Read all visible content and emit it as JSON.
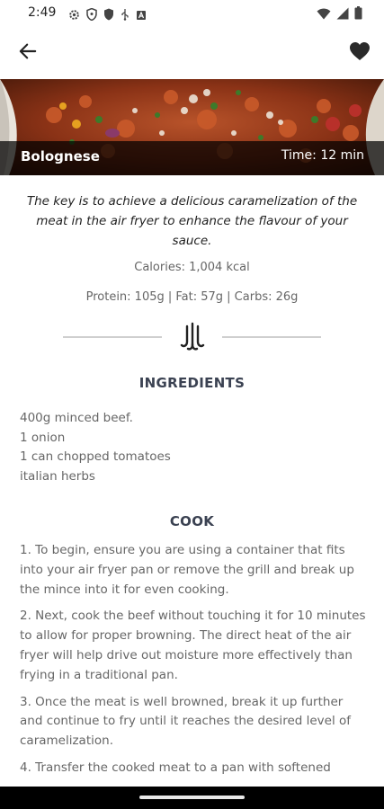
{
  "status_bar": {
    "time": "2:49",
    "left_icons": [
      "settings-gear-icon",
      "shield-icon",
      "shield-icon",
      "usb-icon",
      "square-a-icon"
    ],
    "right_icons": [
      "wifi-icon",
      "cell-signal-icon",
      "battery-icon"
    ]
  },
  "app_bar": {
    "back_icon": "arrow-left-icon",
    "favorite_icon": "heart-icon"
  },
  "recipe": {
    "title": "Bolognese",
    "time": "Time: 12 min",
    "intro": "The key is to achieve a delicious caramelization of the meat in the air fryer to enhance the flavour of your sauce.",
    "calories": "Calories: 1,004 kcal",
    "macros": "Protein: 105g | Fat: 57g | Carbs: 26g"
  },
  "sections": {
    "ingredients_title": "INGREDIENTS",
    "cook_title": "COOK"
  },
  "ingredients": [
    "400g minced beef.",
    "1 onion",
    "1 can chopped tomatoes",
    "italian herbs"
  ],
  "steps": [
    "1. To begin, ensure you are using a container that fits into your air fryer pan or remove the grill and break up the mince into it for even cooking.",
    "2. Next, cook the beef without touching it for 10 minutes to allow for proper browning. The direct heat of the air fryer will help drive out moisture more effectively than frying in a traditional pan.",
    "3. Once the meat is well browned, break it up further and continue to fry until it reaches the desired level of caramelization.",
    "4. Transfer the cooked meat to a pan with softened"
  ]
}
